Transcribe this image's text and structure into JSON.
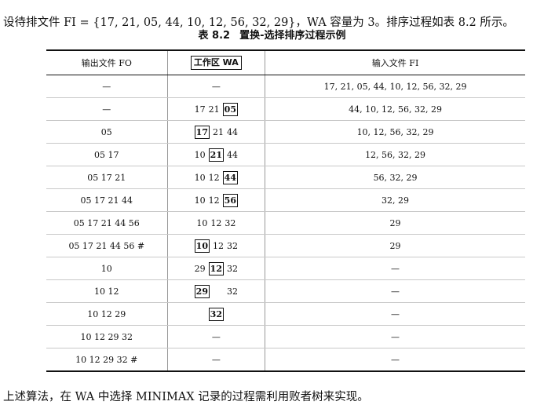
{
  "intro": "设待排文件 FI = {17, 21, 05, 44, 10, 12, 56, 32, 29}，WA 容量为 3。排序过程如表 8.2 所示。",
  "caption": {
    "number": "表 8.2",
    "title": "置换-选择排序过程示例"
  },
  "table": {
    "headers": {
      "fo": "输出文件 FO",
      "wa": "工作区 WA",
      "fi": "输入文件 FI"
    },
    "rows": [
      {
        "fo": "—",
        "wa": [
          {
            "t": "—"
          }
        ],
        "fi": "17, 21, 05, 44, 10, 12, 56, 32, 29"
      },
      {
        "fo": "—",
        "wa": [
          {
            "t": "17"
          },
          {
            "t": "21"
          },
          {
            "t": "05",
            "sel": true
          }
        ],
        "fi": "44, 10, 12, 56, 32, 29"
      },
      {
        "fo": "05",
        "wa": [
          {
            "t": "17",
            "sel": true
          },
          {
            "t": "21"
          },
          {
            "t": "44"
          }
        ],
        "fi": "10, 12, 56, 32, 29"
      },
      {
        "fo": "05 17",
        "wa": [
          {
            "t": "10"
          },
          {
            "t": "21",
            "sel": true
          },
          {
            "t": "44"
          }
        ],
        "fi": "12, 56, 32, 29"
      },
      {
        "fo": "05 17 21",
        "wa": [
          {
            "t": "10"
          },
          {
            "t": "12"
          },
          {
            "t": "44",
            "sel": true
          }
        ],
        "fi": "56, 32, 29"
      },
      {
        "fo": "05 17 21 44",
        "wa": [
          {
            "t": "10"
          },
          {
            "t": "12"
          },
          {
            "t": "56",
            "sel": true
          }
        ],
        "fi": "32, 29"
      },
      {
        "fo": "05 17 21 44 56",
        "wa": [
          {
            "t": "10"
          },
          {
            "t": "12"
          },
          {
            "t": "32"
          }
        ],
        "fi": "29"
      },
      {
        "fo": "05 17 21 44 56 #",
        "wa": [
          {
            "t": "10",
            "sel": true
          },
          {
            "t": "12"
          },
          {
            "t": "32"
          }
        ],
        "fi": "29"
      },
      {
        "fo": "10",
        "wa": [
          {
            "t": "29"
          },
          {
            "t": "12",
            "sel": true
          },
          {
            "t": "32"
          }
        ],
        "fi": "—"
      },
      {
        "fo": "10 12",
        "wa": [
          {
            "t": "29",
            "sel": true
          },
          {
            "t": ""
          },
          {
            "t": "32"
          }
        ],
        "fi": "—"
      },
      {
        "fo": "10 12 29",
        "wa": [
          {
            "t": "32",
            "sel": true
          }
        ],
        "fi": "—"
      },
      {
        "fo": "10 12 29 32",
        "wa": [
          {
            "t": "—"
          }
        ],
        "fi": "—"
      },
      {
        "fo": "10 12 29 32 #",
        "wa": [
          {
            "t": "—"
          }
        ],
        "fi": "—"
      }
    ]
  },
  "outro": "上述算法，在 WA 中选择 MINIMAX 记录的过程需利用败者树来实现。"
}
